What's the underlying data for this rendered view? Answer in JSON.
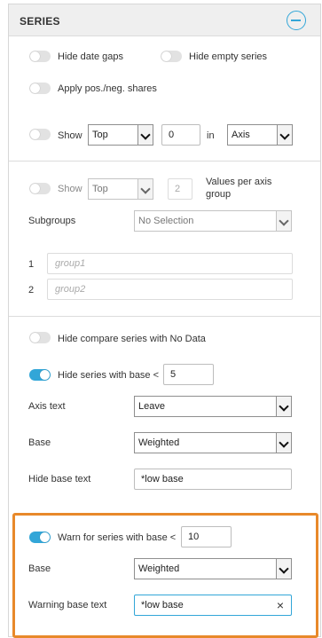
{
  "header": {
    "title": "SERIES"
  },
  "section1": {
    "hide_date_gaps": "Hide date gaps",
    "hide_empty_series": "Hide empty series",
    "apply_shares": "Apply pos./neg. shares",
    "show_label": "Show",
    "show_select": "Top",
    "show_count": "0",
    "in_label": "in",
    "in_select": "Axis"
  },
  "section2": {
    "show_label": "Show",
    "show_select": "Top",
    "show_count": "2",
    "values_label": "Values per axis group",
    "subgroups_label": "Subgroups",
    "subgroups_select": "No Selection",
    "groups": [
      {
        "index": "1",
        "placeholder": "group1"
      },
      {
        "index": "2",
        "placeholder": "group2"
      }
    ]
  },
  "section3": {
    "hide_compare": "Hide compare series with No Data",
    "hide_base_label": "Hide series with base <",
    "hide_base_value": "5",
    "axis_text_label": "Axis text",
    "axis_text_select": "Leave",
    "base_label": "Base",
    "base_select": "Weighted",
    "hide_base_text_label": "Hide base text",
    "hide_base_text_value": "*low base"
  },
  "section4": {
    "warn_label": "Warn for series with base <",
    "warn_value": "10",
    "base_label": "Base",
    "base_select": "Weighted",
    "warning_text_label": "Warning base text",
    "warning_text_value": "*low base",
    "clear_icon": "×"
  },
  "colors": {
    "accent": "#32a6d8",
    "highlight": "#e8892a"
  }
}
